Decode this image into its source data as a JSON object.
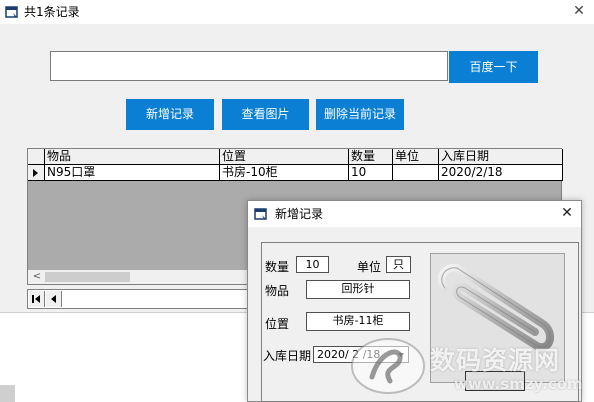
{
  "main_window": {
    "title": "共1条记录",
    "close_glyph": "✕",
    "title_icon": "app-window-icon"
  },
  "search": {
    "value": "",
    "placeholder": "",
    "button_label": "百度一下"
  },
  "toolbar": {
    "add_label": "新增记录",
    "view_label": "查看图片",
    "delete_label": "删除当前记录"
  },
  "grid": {
    "columns": [
      "物品",
      "位置",
      "数量",
      "单位",
      "入库日期"
    ],
    "rows": [
      {
        "item": "N95口罩",
        "location": "书房-10柜",
        "quantity": "10",
        "unit": "",
        "date": "2020/2/18"
      }
    ],
    "scroll_left_glyph": "<"
  },
  "dialog": {
    "title": "新增记录",
    "close_glyph": "✕",
    "quantity_label": "数量",
    "quantity_value": "10",
    "unit_label": "单位",
    "unit_value": "只",
    "item_label": "物品",
    "item_value": "回形针",
    "location_label": "位置",
    "location_value": "书房-11柜",
    "date_label": "入库日期",
    "date_value": "2020/ 2 /18",
    "photo_icon": "paperclip-photo"
  },
  "watermark": {
    "name": "数码资源网",
    "url": "www.smzy.com"
  },
  "colors": {
    "accent_button": "#0a7fd4",
    "window_bg": "#f0f0f0",
    "grid_bg": "#ababab"
  }
}
